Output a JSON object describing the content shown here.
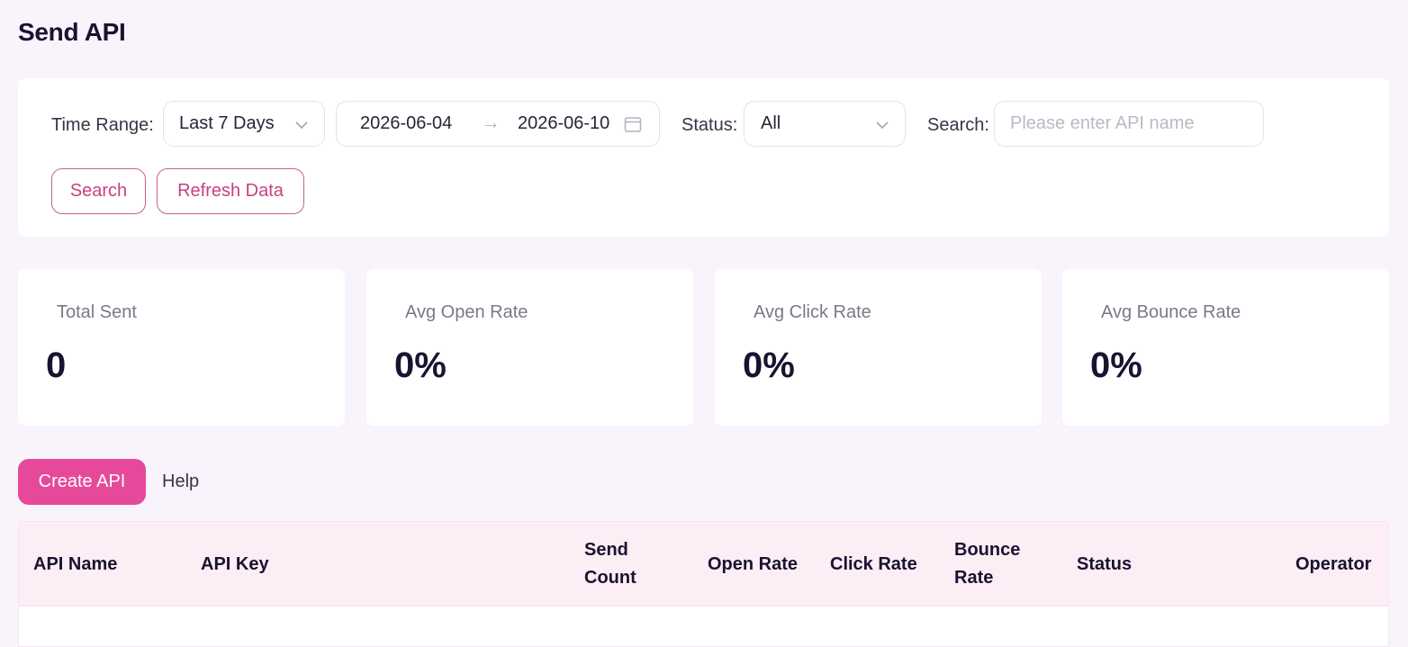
{
  "page": {
    "title": "Send API"
  },
  "filters": {
    "time_range_label": "Time Range:",
    "time_range_value": "Last 7 Days",
    "date_start": "2026-06-04",
    "date_end": "2026-06-10",
    "date_separator": "→",
    "status_label": "Status:",
    "status_value": "All",
    "search_label": "Search:",
    "search_placeholder": "Please enter API name",
    "search_value": "",
    "search_button": "Search",
    "refresh_button": "Refresh Data"
  },
  "stats": [
    {
      "label": "Total Sent",
      "value": "0"
    },
    {
      "label": "Avg Open Rate",
      "value": "0%"
    },
    {
      "label": "Avg Click Rate",
      "value": "0%"
    },
    {
      "label": "Avg Bounce Rate",
      "value": "0%"
    }
  ],
  "actions": {
    "create_button": "Create API",
    "help_link": "Help"
  },
  "table": {
    "columns": [
      {
        "line1": "API Name",
        "line2": ""
      },
      {
        "line1": "API Key",
        "line2": ""
      },
      {
        "line1": "Send",
        "line2": "Count"
      },
      {
        "line1": "Open Rate",
        "line2": ""
      },
      {
        "line1": "Click Rate",
        "line2": ""
      },
      {
        "line1": "Bounce",
        "line2": "Rate"
      },
      {
        "line1": "Status",
        "line2": ""
      },
      {
        "line1": "Operator",
        "line2": ""
      }
    ],
    "rows": []
  },
  "colors": {
    "accent": "#e6499a",
    "accent_outline": "#c9608f",
    "background": "#f9f3fc",
    "table_header": "#fdedf5"
  }
}
